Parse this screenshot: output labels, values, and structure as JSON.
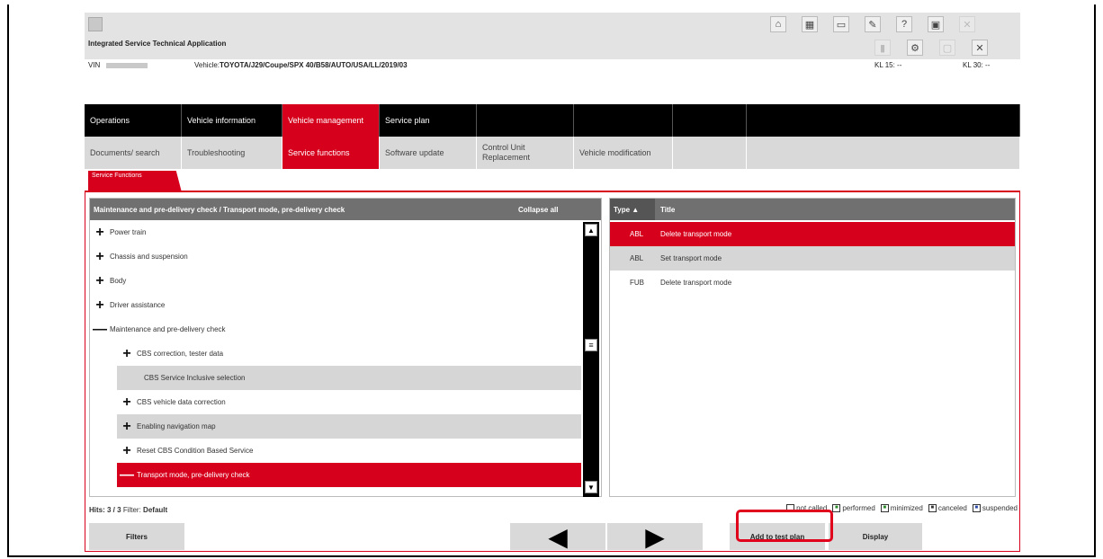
{
  "app": {
    "title": "Integrated Service Technical Application",
    "toolbar_icons": [
      "home-icon",
      "grid-icon",
      "screen-icon",
      "wrench-icon",
      "help-icon",
      "minimize-icon",
      "close-icon"
    ],
    "toolbar2_icons": [
      "connection-icon",
      "settings-icon",
      "window-icon",
      "close-small-icon"
    ]
  },
  "vehicle": {
    "vin_label": "VIN",
    "vehicle_label": "Vehicle:",
    "vehicle_value": "TOYOTA/J29/Coupe/SPX 40/B58/AUTO/USA/LL/2019/03",
    "kl15": "KL 15: --",
    "kl30": "KL 30: --"
  },
  "mainnav": [
    {
      "label": "Operations"
    },
    {
      "label": "Vehicle information"
    },
    {
      "label": "Vehicle management"
    },
    {
      "label": "Service plan"
    },
    {
      "label": ""
    },
    {
      "label": ""
    },
    {
      "label": ""
    },
    {
      "label": ""
    }
  ],
  "subnav": [
    {
      "label": "Documents/ search"
    },
    {
      "label": "Troubleshooting"
    },
    {
      "label": "Service functions"
    },
    {
      "label": "Software update"
    },
    {
      "label": "Control Unit Replacement"
    },
    {
      "label": "Vehicle modification"
    },
    {
      "label": ""
    },
    {
      "label": ""
    }
  ],
  "tab": {
    "label": "Service Functions"
  },
  "left_panel": {
    "breadcrumb": "Maintenance and pre-delivery check / Transport mode, pre-delivery check",
    "collapse_label": "Collapse all",
    "tree": [
      {
        "label": "Power train",
        "expander": "+"
      },
      {
        "label": "Chassis and suspension",
        "expander": "+"
      },
      {
        "label": "Body",
        "expander": "+"
      },
      {
        "label": "Driver assistance",
        "expander": "+"
      },
      {
        "label": "Maintenance and pre-delivery check",
        "expander": "—"
      },
      {
        "label": "CBS correction, tester data",
        "expander": "+"
      },
      {
        "label": "CBS Service Inclusive selection",
        "expander": ""
      },
      {
        "label": "CBS vehicle data correction",
        "expander": "+"
      },
      {
        "label": "Enabling navigation map",
        "expander": "+"
      },
      {
        "label": "Reset CBS Condition Based Service",
        "expander": "+"
      },
      {
        "label": "Transport mode, pre-delivery check",
        "expander": "—"
      }
    ]
  },
  "right_panel": {
    "col_type": "Type ▲",
    "col_title": "Title",
    "rows": [
      {
        "type": "ABL",
        "title": "Delete transport mode"
      },
      {
        "type": "ABL",
        "title": "Set transport mode"
      },
      {
        "type": "FUB",
        "title": "Delete transport mode"
      }
    ]
  },
  "status": {
    "hits": "Hits: 3 / 3",
    "filter_label": "Filter:",
    "filter_value": "Default",
    "legend": [
      "not called",
      "performed",
      "minimized",
      "canceled",
      "suspended"
    ]
  },
  "buttons": {
    "filters": "Filters",
    "back": "◀",
    "forward": "▶",
    "add_to_test_plan": "Add to test plan",
    "display": "Display"
  },
  "colors": {
    "accent": "#d6001c",
    "highlight": "#e0001c"
  }
}
